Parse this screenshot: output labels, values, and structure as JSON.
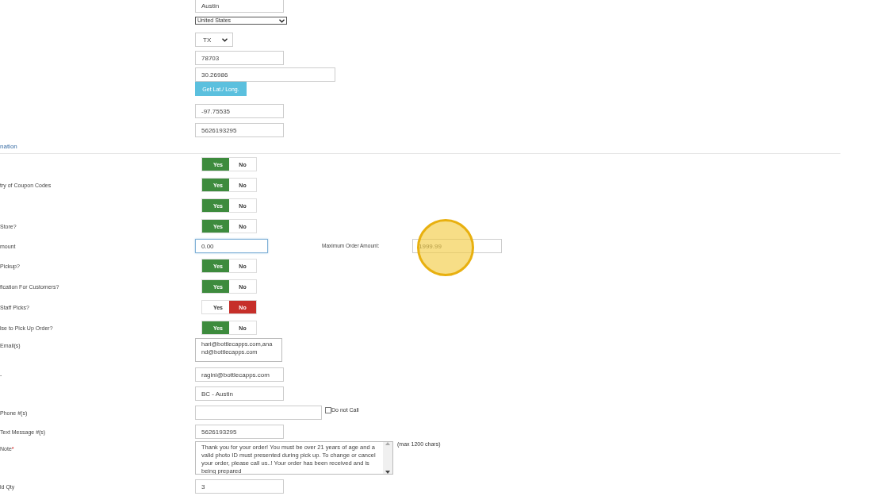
{
  "rows": [
    {
      "kind": "input",
      "label": "",
      "value": "Austin"
    },
    {
      "kind": "select-small",
      "label": "",
      "value": "United States"
    },
    {
      "kind": "select",
      "label": "",
      "value": "TX"
    },
    {
      "kind": "input",
      "label": "",
      "value": "78703"
    },
    {
      "kind": "coords",
      "label": "",
      "value": "30.26986",
      "button": "Get Lat./ Long."
    },
    {
      "kind": "input",
      "label": "",
      "value": "-97.75535"
    },
    {
      "kind": "input",
      "label": "",
      "value": "5626193295"
    },
    {
      "kind": "section",
      "label": "nation"
    },
    {
      "kind": "toggle",
      "label": "",
      "options": [
        {
          "label": "Yes",
          "selected": true
        },
        {
          "label": "No",
          "selected": false
        }
      ]
    },
    {
      "kind": "toggle",
      "label": "try of Coupon Codes",
      "options": [
        {
          "label": "Yes",
          "selected": true
        },
        {
          "label": "No",
          "selected": false
        }
      ]
    },
    {
      "kind": "toggle",
      "label": "",
      "options": [
        {
          "label": "Yes",
          "selected": true
        },
        {
          "label": "No",
          "selected": false
        }
      ]
    },
    {
      "kind": "toggle",
      "label": "Store?",
      "options": [
        {
          "label": "Yes",
          "selected": true
        },
        {
          "label": "No",
          "selected": false
        }
      ]
    },
    {
      "kind": "amount",
      "label": "mount",
      "value": "0.00",
      "focused": true,
      "second_label": "Maximum Order Amount:",
      "second_value": "1999.99"
    },
    {
      "kind": "toggle",
      "label": "Pickup?",
      "options": [
        {
          "label": "Yes",
          "selected": true
        },
        {
          "label": "No",
          "selected": false
        }
      ]
    },
    {
      "kind": "toggle",
      "label": "fication For Customers?",
      "options": [
        {
          "label": "Yes",
          "selected": true
        },
        {
          "label": "No",
          "selected": false
        }
      ]
    },
    {
      "kind": "toggle",
      "label": "Staff Picks?",
      "options": [
        {
          "label": "Yes",
          "selected": false
        },
        {
          "label": "No",
          "selected": true
        }
      ]
    },
    {
      "kind": "toggle",
      "label": "lse to Pick Up Order?",
      "options": [
        {
          "label": "Yes",
          "selected": true
        },
        {
          "label": "No",
          "selected": false
        }
      ]
    },
    {
      "kind": "textarea",
      "label": "Email(s)",
      "value": "hari@bottlecapps.com,anand@bottlecapps.com"
    },
    {
      "kind": "input",
      "label": "-",
      "value": "ragini@bottlecapps.com"
    },
    {
      "kind": "input",
      "label": "",
      "value": "BC - Austin"
    },
    {
      "kind": "phone",
      "label": "Phone #(s)",
      "value": "",
      "checkbox": {
        "label": "Do not Call",
        "checked": false
      }
    },
    {
      "kind": "input",
      "label": "Text Message #(s)",
      "value": "5626193295"
    },
    {
      "kind": "note",
      "label": "Note",
      "required_mark": "*",
      "value": "Thank you for your order! You must be over 21 years of age and a valid photo ID must presented during pick up. To change or cancel your order, please call us..! Your order has been received and is being prepared",
      "hint": "(max 1200 chars)"
    },
    {
      "kind": "input",
      "label": "ld Qty",
      "value": "3"
    }
  ]
}
